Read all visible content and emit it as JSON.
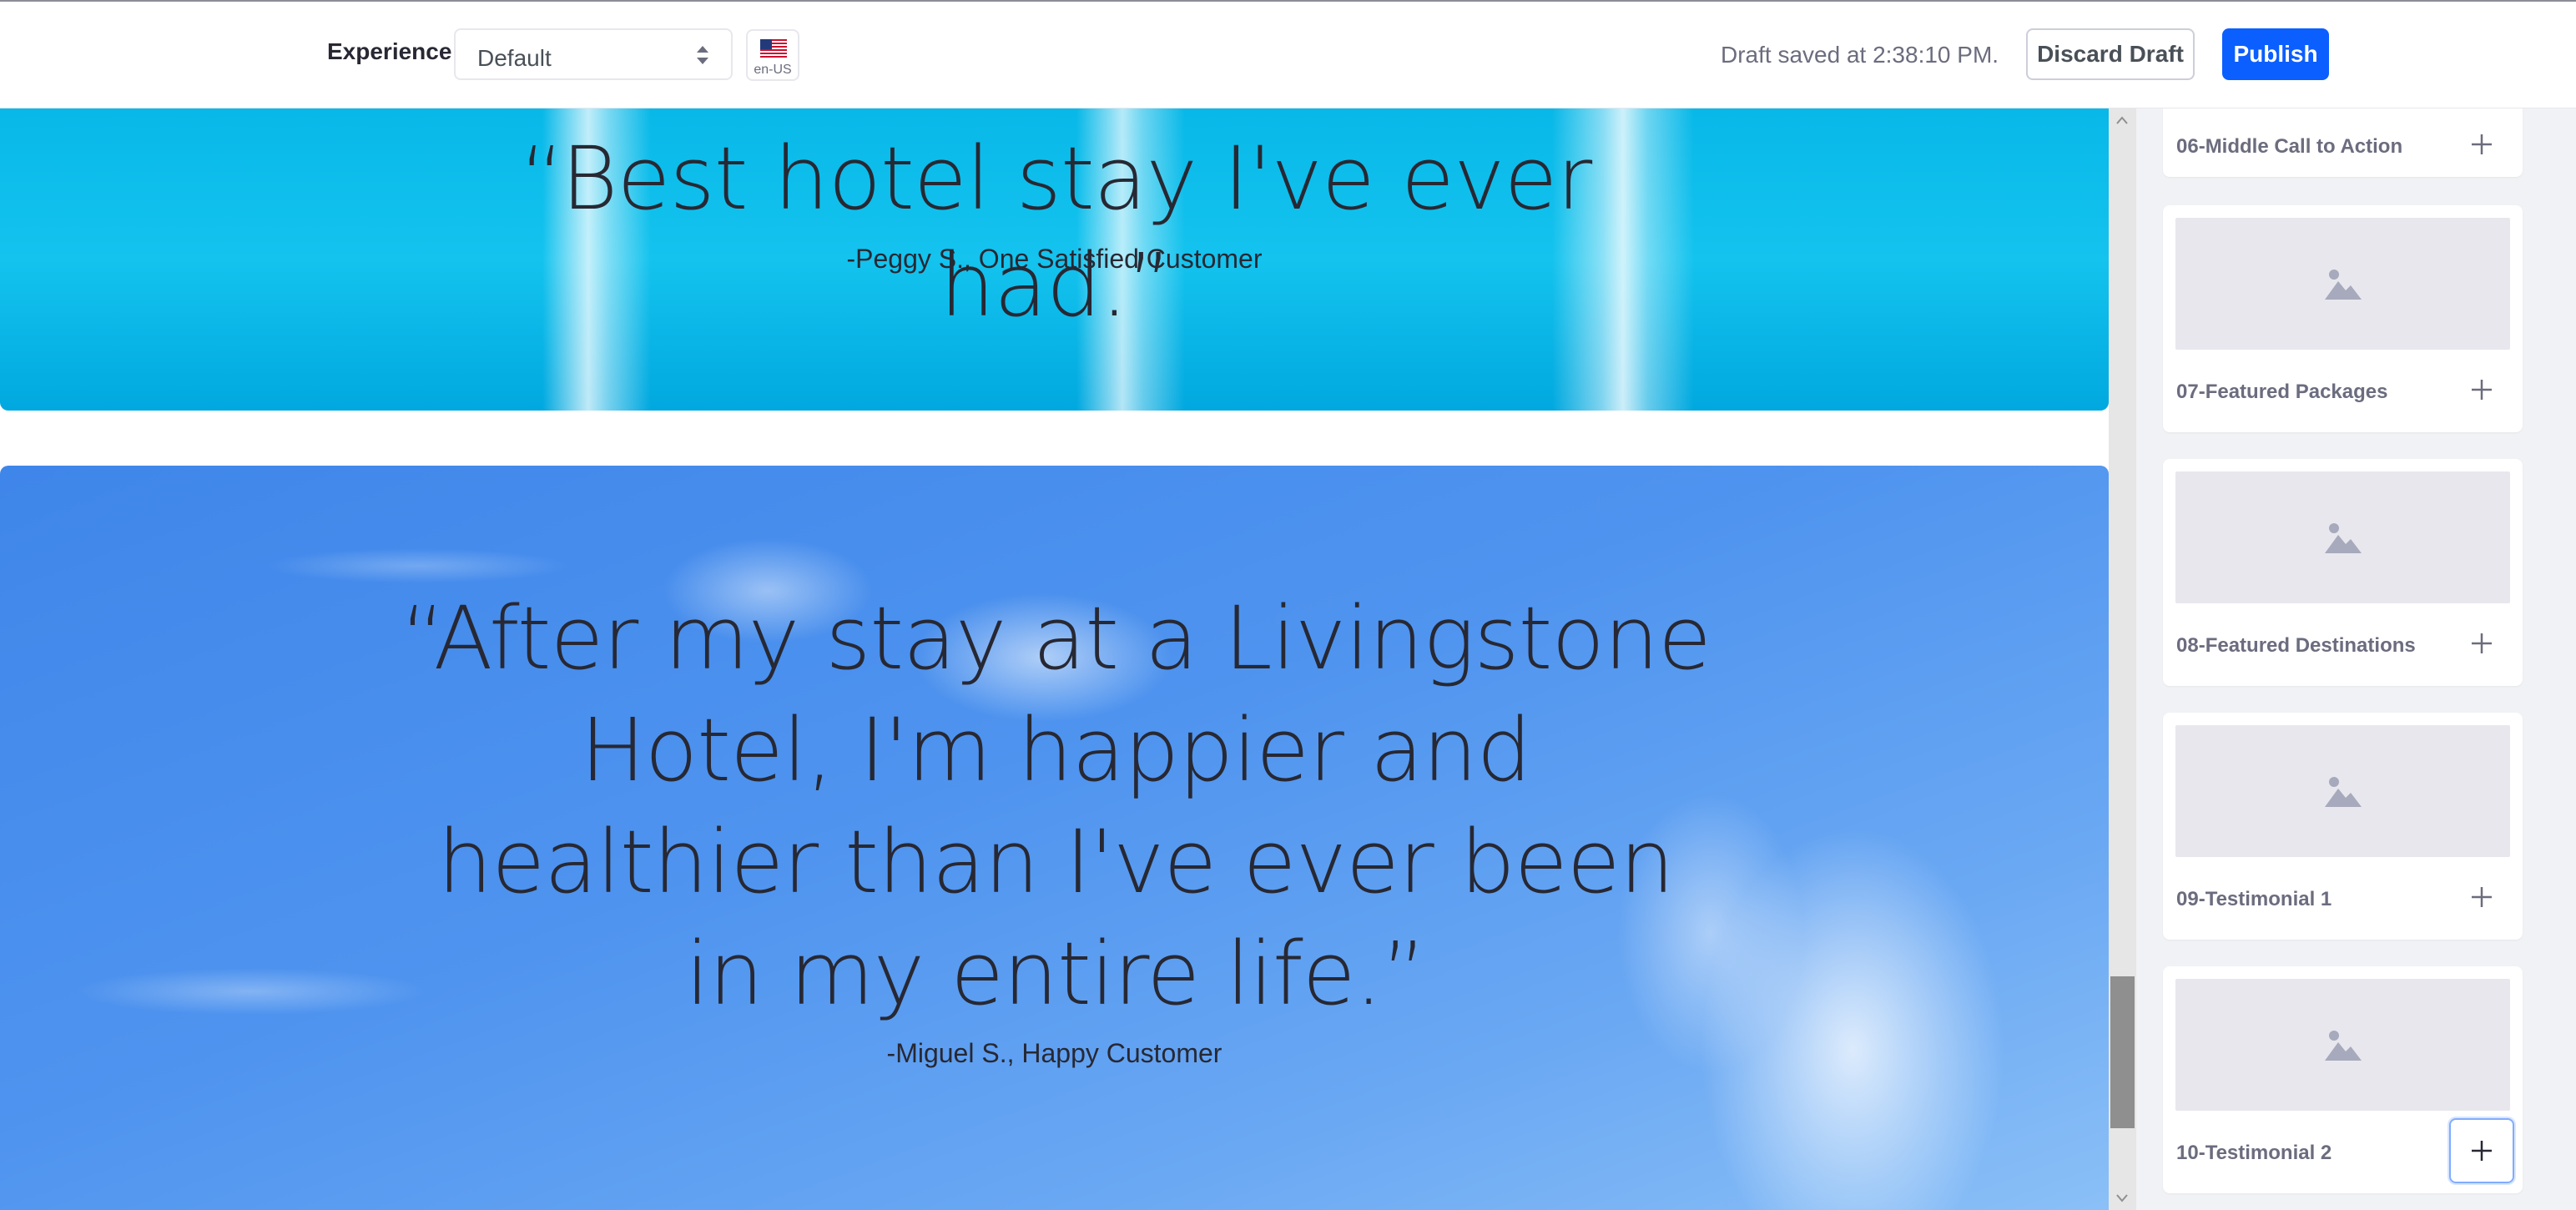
{
  "toolbar": {
    "experience_label": "Experience",
    "experience_value": "Default",
    "locale_code": "en-US",
    "locale_flag_icon": "us-flag-icon",
    "draft_status": "Draft saved at 2:38:10 PM.",
    "discard_label": "Discard Draft",
    "publish_label": "Publish",
    "publish_color": "#0b5fff"
  },
  "canvas": {
    "testimonial_1": {
      "quote": "“Best hotel stay I've ever had.”",
      "author": "-Peggy S., One Satisfied Customer"
    },
    "testimonial_2": {
      "quote": "“After my stay at a Livingstone Hotel, I'm happier and healthier than I've ever been in my entire life.”",
      "author": "-Miguel S., Happy Customer"
    }
  },
  "sidebar": {
    "fragments": [
      {
        "label": "06-Middle Call to Action",
        "thumbnail_icon": "image-placeholder-icon",
        "add_icon": "plus-icon"
      },
      {
        "label": "07-Featured Packages",
        "thumbnail_icon": "image-placeholder-icon",
        "add_icon": "plus-icon"
      },
      {
        "label": "08-Featured Destinations",
        "thumbnail_icon": "image-placeholder-icon",
        "add_icon": "plus-icon"
      },
      {
        "label": "09-Testimonial 1",
        "thumbnail_icon": "image-placeholder-icon",
        "add_icon": "plus-icon"
      },
      {
        "label": "10-Testimonial 2",
        "thumbnail_icon": "image-placeholder-icon",
        "add_icon": "plus-icon"
      }
    ]
  }
}
